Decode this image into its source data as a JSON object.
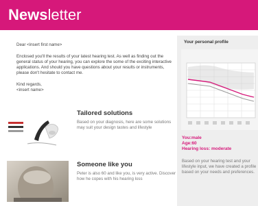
{
  "header": {
    "brand_bold": "News",
    "brand_rest": "letter",
    "color": "#d6187a"
  },
  "letter": {
    "greeting": "Dear <insert first name>",
    "intro": "Enclosed you'll the results of your latest hearing test. As well as finding out the general status of your hearing, you can explore the some of the exciting interactive applications. And should you have questions about your results or instruments, please don't hesitate to contact me.",
    "closing": "Kind regards,",
    "signature": "<insert name>"
  },
  "features": [
    {
      "title": "Tailored solutions",
      "desc": "Based on your diagnosis, here are some solutions may suit your design tastes and lifestyle",
      "icon": "hearing-aid-image"
    },
    {
      "title": "Someone like you",
      "desc": "Peter is also 60 and like you, is very active. Discover how he copes with his hearing loss",
      "icon": "person-photo"
    }
  ],
  "sidebar": {
    "title": "Your personal profile",
    "profile_lines": [
      "You:male",
      "Age:60",
      "Hearing loss: moderate"
    ],
    "desc": "Based on your hearing test and your lifestyle input, we have created a profile based on your needs and preferences."
  }
}
